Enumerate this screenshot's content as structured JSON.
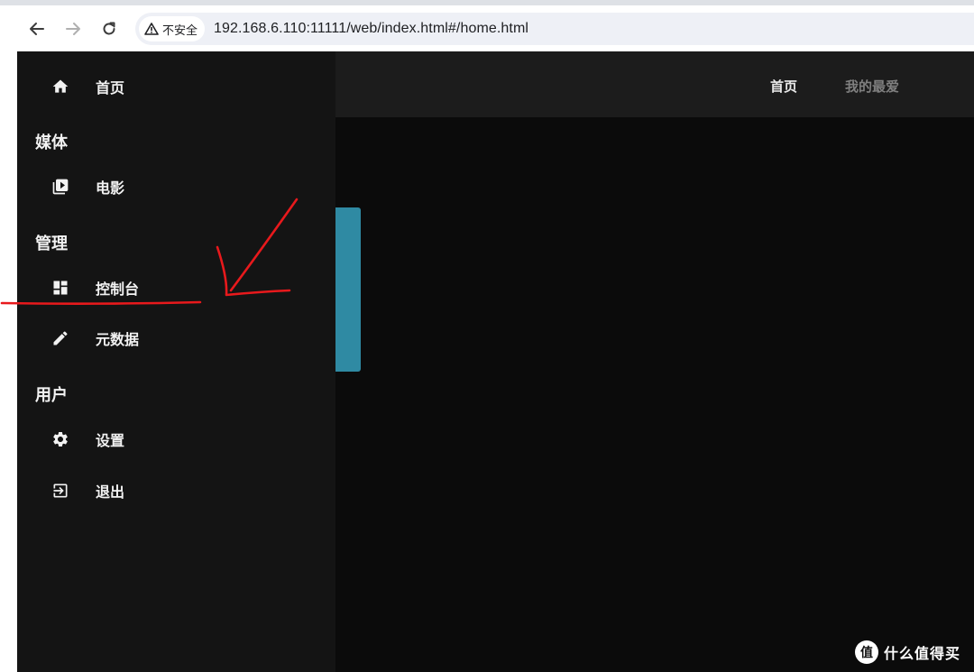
{
  "browser": {
    "security_label": "不安全",
    "url": "192.168.6.110:11111/web/index.html#/home.html",
    "icons": {
      "back": "arrow-left-icon",
      "forward": "arrow-right-icon",
      "reload": "reload-icon",
      "security": "warning-triangle-icon"
    }
  },
  "header": {
    "tabs": [
      {
        "label": "首页",
        "active": true
      },
      {
        "label": "我的最爱",
        "active": false
      }
    ]
  },
  "sidebar": {
    "home": {
      "label": "首页",
      "icon": "home-icon"
    },
    "sections": [
      {
        "title": "媒体",
        "items": [
          {
            "label": "电影",
            "icon": "video-library-icon"
          }
        ]
      },
      {
        "title": "管理",
        "items": [
          {
            "label": "控制台",
            "icon": "dashboard-icon"
          },
          {
            "label": "元数据",
            "icon": "pencil-icon"
          }
        ]
      },
      {
        "title": "用户",
        "items": [
          {
            "label": "设置",
            "icon": "gear-icon"
          },
          {
            "label": "退出",
            "icon": "exit-icon"
          }
        ]
      }
    ]
  },
  "watermark": {
    "text": "什么值得买",
    "logo_char": "值"
  },
  "colors": {
    "drawer_bg": "#141414",
    "content_bg": "#0b0b0b",
    "header_bg": "#1c1c1c",
    "accent_teal": "#2f8aa3",
    "annotation_red": "#e8191c"
  }
}
